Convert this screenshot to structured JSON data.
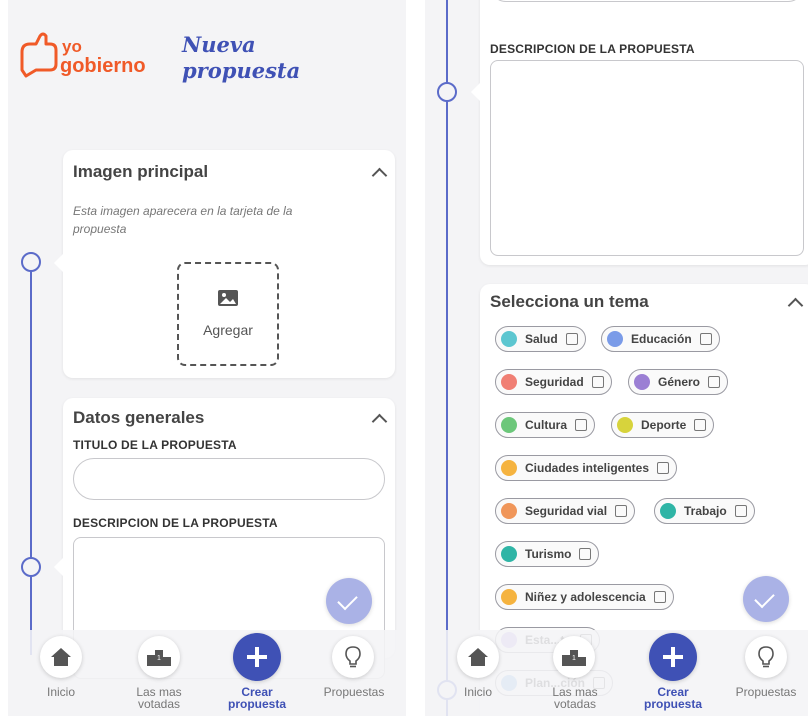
{
  "brand": {
    "logo_text": "yo gobierno",
    "page_title_line1": "Nueva",
    "page_title_line2": "propuesta",
    "color": "#f05a28"
  },
  "image_card": {
    "title": "Imagen principal",
    "hint": "Esta imagen aparecera en la tarjeta de la propuesta",
    "add_label": "Agregar"
  },
  "general_card": {
    "title": "Datos generales",
    "title_label": "TITULO DE LA PROPUESTA",
    "description_label": "DESCRIPCION DE LA PROPUESTA",
    "title_value": "",
    "description_value": ""
  },
  "right_panel": {
    "description_label": "DESCRIPCION DE LA PROPUESTA"
  },
  "theme_card": {
    "title": "Selecciona un tema",
    "topics": [
      {
        "label": "Salud",
        "color": "#5cc6d0"
      },
      {
        "label": "Educación",
        "color": "#7a9be8"
      },
      {
        "label": "Seguridad",
        "color": "#f07f74"
      },
      {
        "label": "Género",
        "color": "#9b7fd4"
      },
      {
        "label": "Cultura",
        "color": "#6cc77a"
      },
      {
        "label": "Deporte",
        "color": "#d7d33c"
      },
      {
        "label": "Ciudades inteligentes",
        "color": "#f5b33f"
      },
      {
        "label": "Seguridad vial",
        "color": "#f0965a"
      },
      {
        "label": "Trabajo",
        "color": "#2fb5a6"
      },
      {
        "label": "Turismo",
        "color": "#2fb5a6"
      },
      {
        "label": "Niñez y adolescencia",
        "color": "#f5b33f"
      },
      {
        "label": "Esta...to",
        "color": "#b9a5e8"
      },
      {
        "label": "Plan...ción",
        "color": "#7fb3e8"
      }
    ]
  },
  "nav": {
    "items": [
      {
        "label": "Inicio",
        "icon": "home-icon"
      },
      {
        "label": "Las mas votadas",
        "icon": "podium-icon"
      },
      {
        "label": "Crear propuesta",
        "icon": "plus-icon"
      },
      {
        "label": "Propuestas",
        "icon": "lightbulb-icon"
      }
    ],
    "active_color": "#3f51b5"
  }
}
